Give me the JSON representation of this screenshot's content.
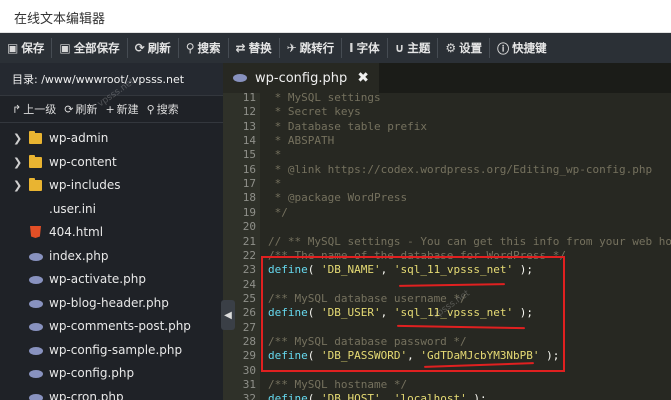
{
  "window": {
    "title": "在线文本编辑器"
  },
  "toolbar": {
    "items": [
      {
        "label": "保存",
        "icon": "save-icon",
        "glyph": "▣"
      },
      {
        "label": "全部保存",
        "icon": "save-all-icon",
        "glyph": "▣"
      },
      {
        "label": "刷新",
        "icon": "refresh-icon",
        "glyph": "⟳"
      },
      {
        "label": "搜索",
        "icon": "search-icon",
        "glyph": "⚲"
      },
      {
        "label": "替换",
        "icon": "replace-icon",
        "glyph": "⇄"
      },
      {
        "label": "跳转行",
        "icon": "goto-line-icon",
        "glyph": "✈"
      },
      {
        "label": "字体",
        "icon": "font-icon",
        "glyph": "I"
      },
      {
        "label": "主题",
        "icon": "theme-icon",
        "glyph": "∪"
      },
      {
        "label": "设置",
        "icon": "gear-icon",
        "glyph": "⚙"
      },
      {
        "label": "快捷键",
        "icon": "shortcut-icon",
        "glyph": "ⓘ"
      }
    ]
  },
  "sidebar": {
    "path": "目录: /www/wwwroot/.vpsss.net",
    "actions": [
      {
        "label": "上一级",
        "icon": "up-level-icon",
        "glyph": "↱"
      },
      {
        "label": "刷新",
        "icon": "refresh-icon",
        "glyph": "⟳"
      },
      {
        "label": "新建",
        "icon": "plus-icon",
        "glyph": "+"
      },
      {
        "label": "搜索",
        "icon": "search-icon",
        "glyph": "⚲"
      }
    ],
    "items": [
      {
        "label": "wp-admin",
        "type": "folder"
      },
      {
        "label": "wp-content",
        "type": "folder"
      },
      {
        "label": "wp-includes",
        "type": "folder"
      },
      {
        "label": ".user.ini",
        "type": "file"
      },
      {
        "label": "404.html",
        "type": "html"
      },
      {
        "label": "index.php",
        "type": "php"
      },
      {
        "label": "wp-activate.php",
        "type": "php"
      },
      {
        "label": "wp-blog-header.php",
        "type": "php"
      },
      {
        "label": "wp-comments-post.php",
        "type": "php"
      },
      {
        "label": "wp-config-sample.php",
        "type": "php"
      },
      {
        "label": "wp-config.php",
        "type": "php"
      },
      {
        "label": "wp-cron.php",
        "type": "php"
      }
    ]
  },
  "editor": {
    "tab": {
      "label": "wp-config.php",
      "close_glyph": "✖"
    },
    "collapse_glyph": "◀",
    "lines": [
      {
        "n": "11",
        "parts": [
          {
            "t": " * MySQL settings",
            "c": "com"
          }
        ]
      },
      {
        "n": "12",
        "parts": [
          {
            "t": " * Secret keys",
            "c": "com"
          }
        ]
      },
      {
        "n": "13",
        "parts": [
          {
            "t": " * Database table prefix",
            "c": "com"
          }
        ]
      },
      {
        "n": "14",
        "parts": [
          {
            "t": " * ABSPATH",
            "c": "com"
          }
        ]
      },
      {
        "n": "15",
        "parts": [
          {
            "t": " *",
            "c": "com"
          }
        ]
      },
      {
        "n": "16",
        "parts": [
          {
            "t": " * @link https://codex.wordpress.org/Editing_wp-config.php",
            "c": "com"
          }
        ]
      },
      {
        "n": "17",
        "parts": [
          {
            "t": " *",
            "c": "com"
          }
        ]
      },
      {
        "n": "18",
        "parts": [
          {
            "t": " * @package WordPress",
            "c": "com"
          }
        ]
      },
      {
        "n": "19",
        "parts": [
          {
            "t": " */",
            "c": "com"
          }
        ]
      },
      {
        "n": "20",
        "parts": [
          {
            "t": "",
            "c": "pl"
          }
        ]
      },
      {
        "n": "21",
        "parts": [
          {
            "t": "// ** MySQL settings - You can get this info from your web host ** //",
            "c": "com"
          }
        ]
      },
      {
        "n": "22",
        "parts": [
          {
            "t": "/** The name of the database for WordPress */",
            "c": "com"
          }
        ]
      },
      {
        "n": "23",
        "parts": [
          {
            "t": "define",
            "c": "fn"
          },
          {
            "t": "( ",
            "c": "pl"
          },
          {
            "t": "'DB_NAME'",
            "c": "str"
          },
          {
            "t": ", ",
            "c": "pl"
          },
          {
            "t": "'sql_11_vpsss_net'",
            "c": "str"
          },
          {
            "t": " );",
            "c": "pl"
          }
        ]
      },
      {
        "n": "24",
        "parts": [
          {
            "t": "",
            "c": "pl"
          }
        ]
      },
      {
        "n": "25",
        "parts": [
          {
            "t": "/** MySQL database username */",
            "c": "com"
          }
        ]
      },
      {
        "n": "26",
        "parts": [
          {
            "t": "define",
            "c": "fn"
          },
          {
            "t": "( ",
            "c": "pl"
          },
          {
            "t": "'DB_USER'",
            "c": "str"
          },
          {
            "t": ", ",
            "c": "pl"
          },
          {
            "t": "'sql_11_vpsss_net'",
            "c": "str"
          },
          {
            "t": " );",
            "c": "pl"
          }
        ]
      },
      {
        "n": "27",
        "parts": [
          {
            "t": "",
            "c": "pl"
          }
        ]
      },
      {
        "n": "28",
        "parts": [
          {
            "t": "/** MySQL database password */",
            "c": "com"
          }
        ]
      },
      {
        "n": "29",
        "parts": [
          {
            "t": "define",
            "c": "fn"
          },
          {
            "t": "( ",
            "c": "pl"
          },
          {
            "t": "'DB_PASSWORD'",
            "c": "str"
          },
          {
            "t": ", ",
            "c": "pl"
          },
          {
            "t": "'GdTDaMJcbYM3NbPB'",
            "c": "str"
          },
          {
            "t": " );",
            "c": "pl"
          }
        ]
      },
      {
        "n": "30",
        "parts": [
          {
            "t": "",
            "c": "pl"
          }
        ]
      },
      {
        "n": "31",
        "parts": [
          {
            "t": "/** MySQL hostname */",
            "c": "com"
          }
        ]
      },
      {
        "n": "32",
        "parts": [
          {
            "t": "define",
            "c": "fn"
          },
          {
            "t": "( ",
            "c": "pl"
          },
          {
            "t": "'DB_HOST'",
            "c": "str"
          },
          {
            "t": ", ",
            "c": "pl"
          },
          {
            "t": "'localhost'",
            "c": "str"
          },
          {
            "t": " );",
            "c": "pl"
          }
        ]
      }
    ]
  },
  "colors": {
    "accent_red": "#e02020",
    "toolbar_bg": "#2b3036",
    "sidebar_bg": "#1f2227",
    "editor_bg": "#272822"
  }
}
